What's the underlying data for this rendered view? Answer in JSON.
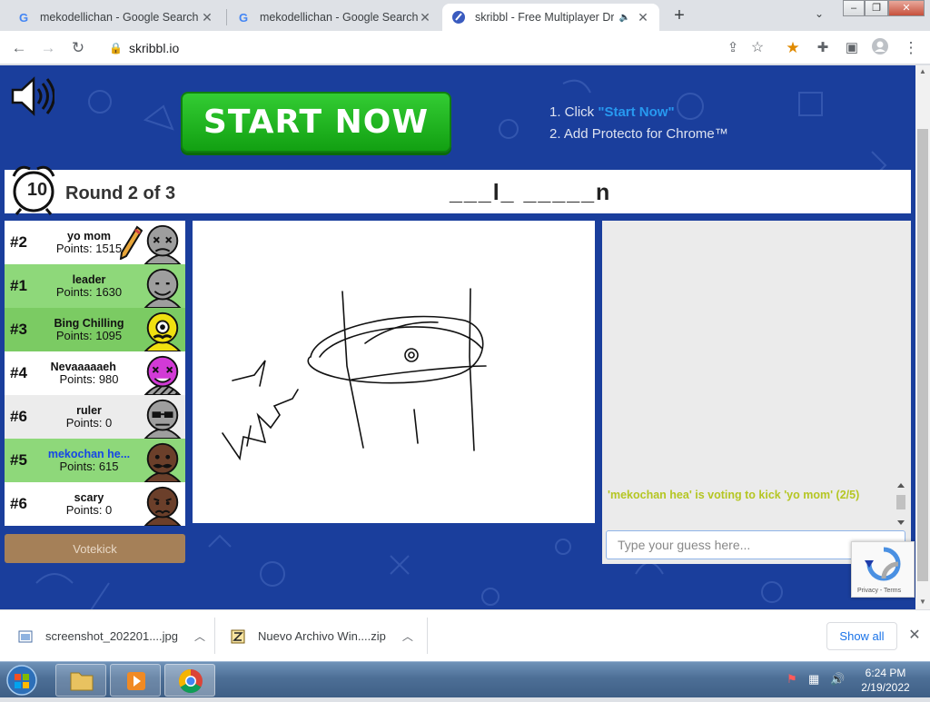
{
  "browser": {
    "tabs": [
      {
        "title": "mekodellichan - Google Search",
        "icon": "google-icon",
        "active": false
      },
      {
        "title": "mekodellichan - Google Search",
        "icon": "google-icon",
        "active": false
      },
      {
        "title": "skribbl - Free Multiplayer Dra",
        "icon": "skribbl-icon",
        "active": true
      }
    ],
    "url": "skribbl.io"
  },
  "ad": {
    "button_label": "START NOW",
    "step1_prefix": "1. Click ",
    "step1_link": "\"Start Now\"",
    "step2": "2. Add Protecto for Chrome™"
  },
  "game": {
    "timer": "10",
    "round_text": "Round 2 of 3",
    "word_hint": "___l_ _____n",
    "players": [
      {
        "rank": "#2",
        "name": "yo mom",
        "points": "Points: 1515",
        "bg": "#ffffff",
        "self": false,
        "drawing": true,
        "avatar_color": "#9e9e9e",
        "face": "dead"
      },
      {
        "rank": "#1",
        "name": "leader",
        "points": "Points: 1630",
        "bg": "#8ed87a",
        "self": false,
        "drawing": false,
        "avatar_color": "#9e9e9e",
        "face": "smile"
      },
      {
        "rank": "#3",
        "name": "Bing Chilling",
        "points": "Points: 1095",
        "bg": "#7bcb63",
        "self": false,
        "drawing": false,
        "avatar_color": "#f0e010",
        "face": "cyclops"
      },
      {
        "rank": "#4",
        "name": "Nevaaaaaeh ",
        "points": "Points: 980",
        "bg": "#ffffff",
        "self": false,
        "drawing": false,
        "avatar_color": "#d23ad6",
        "face": "crazy"
      },
      {
        "rank": "#6",
        "name": "ruler",
        "points": "Points: 0",
        "bg": "#ececec",
        "self": false,
        "drawing": false,
        "avatar_color": "#9e9e9e",
        "face": "shades"
      },
      {
        "rank": "#5",
        "name": "mekochan he...",
        "points": "Points: 615",
        "bg": "#8ed87a",
        "self": true,
        "drawing": false,
        "avatar_color": "#6b3f2a",
        "face": "mustache"
      },
      {
        "rank": "#6",
        "name": "scary",
        "points": "Points: 0",
        "bg": "#ffffff",
        "self": false,
        "drawing": false,
        "avatar_color": "#6b3f2a",
        "face": "worried"
      }
    ],
    "votekick_label": "Votekick",
    "chat_message": "'mekochan hea' is voting to kick 'yo mom' (2/5)",
    "guess_placeholder": "Type your guess here...",
    "recaptcha_text": "Privacy - Terms"
  },
  "downloads": {
    "items": [
      {
        "name": "screenshot_202201....jpg",
        "icon": "image-file-icon"
      },
      {
        "name": "Nuevo Archivo Win....zip",
        "icon": "zip-file-icon"
      }
    ],
    "show_all_label": "Show all"
  },
  "taskbar": {
    "time": "6:24 PM",
    "date": "2/19/2022"
  },
  "colors": {
    "page_bg": "#1a3e9c",
    "start_now_green": "#1fb31f",
    "chat_vote_text": "#b5c623",
    "self_name": "#1646e6"
  }
}
